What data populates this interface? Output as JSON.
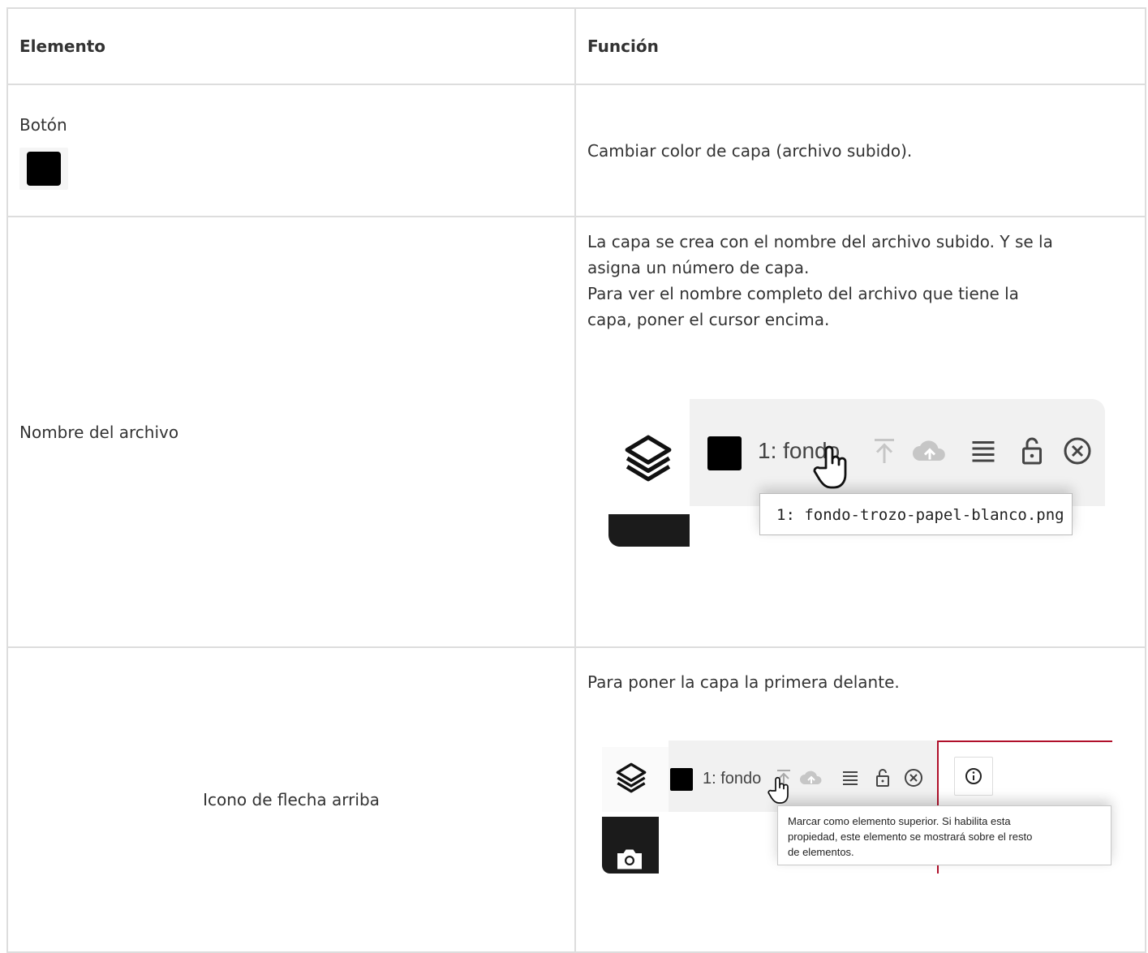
{
  "table": {
    "headers": [
      "Elemento",
      "Función"
    ],
    "rows": [
      {
        "element_label": "Botón",
        "function_text": "Cambiar color de capa (archivo subido)."
      },
      {
        "element_label": "Nombre del archivo",
        "function_lines": [
          "La capa se crea con el nombre del archivo subido.  Y se la",
          "asigna un número de capa.",
          "Para ver el nombre completo del archivo que tiene la",
          "capa,  poner el cursor encima."
        ],
        "screenshot": {
          "layer_name": "1: fondo",
          "tooltip": "1: fondo-trozo-papel-blanco.png"
        }
      },
      {
        "element_label": "Icono de flecha arriba",
        "function_text": "Para poner la capa la primera delante.",
        "screenshot": {
          "layer_name": "1: fondo",
          "tooltip_lines": [
            "Marcar como elemento superior. Si habilita esta",
            "propiedad, este elemento se mostrará sobre el resto",
            "de elementos."
          ]
        }
      }
    ]
  },
  "colors": {
    "border": "#dddddd",
    "text": "#333333",
    "swatch": "#000000",
    "accent_red": "#b0102a"
  },
  "icons": [
    "layers-icon",
    "arrow-to-top-icon",
    "cloud-upload-icon",
    "lines-icon",
    "unlock-icon",
    "close-circle-icon",
    "hand-pointer-icon",
    "camera-icon",
    "info-icon"
  ]
}
